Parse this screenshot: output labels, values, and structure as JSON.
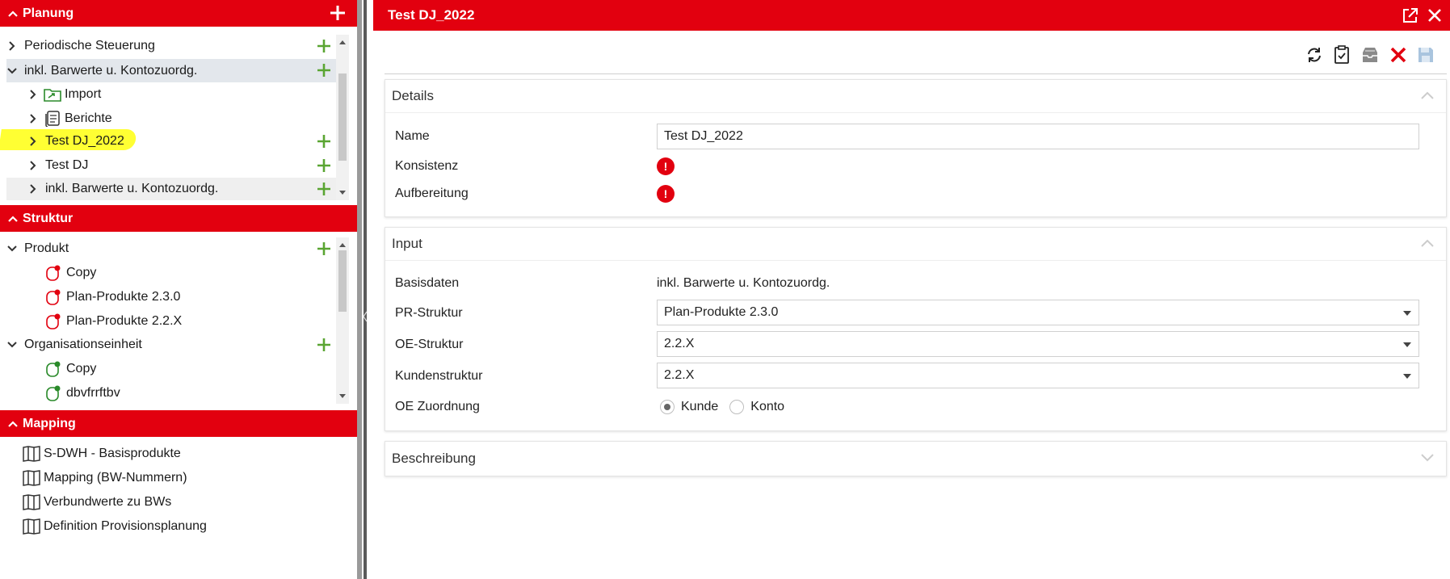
{
  "left": {
    "planung": {
      "title": "Planung",
      "items": [
        {
          "label": "Periodische Steuerung"
        },
        {
          "label": "inkl. Barwerte u. Kontozuordg."
        },
        {
          "label": "Import"
        },
        {
          "label": "Berichte"
        },
        {
          "label": "Test DJ_2022"
        },
        {
          "label": "Test DJ"
        },
        {
          "label": "inkl. Barwerte u. Kontozuordg."
        }
      ]
    },
    "struktur": {
      "title": "Struktur",
      "items": [
        {
          "label": "Produkt"
        },
        {
          "label": "Copy"
        },
        {
          "label": "Plan-Produkte 2.3.0"
        },
        {
          "label": "Plan-Produkte 2.2.X"
        },
        {
          "label": "Organisationseinheit"
        },
        {
          "label": "Copy"
        },
        {
          "label": "dbvfrrftbv"
        }
      ]
    },
    "mapping": {
      "title": "Mapping",
      "items": [
        {
          "label": "S-DWH - Basisprodukte"
        },
        {
          "label": "Mapping (BW-Nummern)"
        },
        {
          "label": "Verbundwerte zu BWs"
        },
        {
          "label": "Definition Provisionsplanung"
        }
      ]
    }
  },
  "right": {
    "title": "Test DJ_2022",
    "details": {
      "title": "Details",
      "name_label": "Name",
      "name_value": "Test DJ_2022",
      "konsistenz_label": "Konsistenz",
      "aufbereitung_label": "Aufbereitung",
      "status_glyph": "!"
    },
    "input": {
      "title": "Input",
      "basisdaten_label": "Basisdaten",
      "basisdaten_value": "inkl. Barwerte u. Kontozuordg.",
      "pr_label": "PR-Struktur",
      "pr_value": "Plan-Produkte 2.3.0",
      "oe_label": "OE-Struktur",
      "oe_value": "2.2.X",
      "kunden_label": "Kundenstruktur",
      "kunden_value": "2.2.X",
      "zuordnung_label": "OE Zuordnung",
      "radio_kunde": "Kunde",
      "radio_konto": "Konto"
    },
    "beschreibung": {
      "title": "Beschreibung"
    }
  },
  "colors": {
    "brand_red": "#e2000f",
    "plus_green": "#5aa532",
    "highlight_yellow": "#ffff33",
    "selected_row": "#e3e7ec"
  },
  "icons": [
    "chevron-up-icon",
    "plus-icon",
    "chevron-right-icon",
    "chevron-down-icon",
    "import-icon",
    "reports-icon",
    "structure-node-icon",
    "map-icon",
    "open-external-icon",
    "close-icon",
    "refresh-icon",
    "clipboard-check-icon",
    "archive-icon",
    "delete-icon",
    "save-icon",
    "error-icon",
    "dropdown-caret-icon"
  ]
}
